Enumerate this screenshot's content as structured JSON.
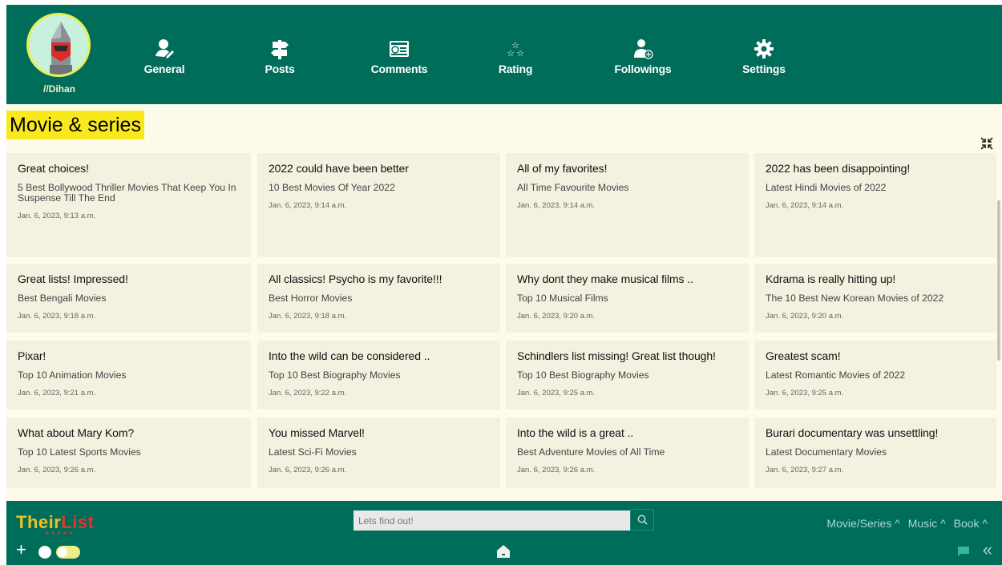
{
  "profile": {
    "username": "//Dihan"
  },
  "nav": [
    {
      "label": "General",
      "icon": "user-pencil-icon"
    },
    {
      "label": "Posts",
      "icon": "signpost-icon"
    },
    {
      "label": "Comments",
      "icon": "comment-card-icon"
    },
    {
      "label": "Rating",
      "icon": "stars-icon"
    },
    {
      "label": "Followings",
      "icon": "user-plus-icon"
    },
    {
      "label": "Settings",
      "icon": "gear-icon"
    }
  ],
  "section": {
    "title": "Movie & series"
  },
  "cards": [
    {
      "title": "Great choices!",
      "list": "5 Best Bollywood Thriller Movies That Keep You In Suspense Till The End",
      "date": "Jan. 6, 2023, 9:13 a.m."
    },
    {
      "title": "2022 could have been better",
      "list": "10 Best Movies Of Year 2022",
      "date": "Jan. 6, 2023, 9:14 a.m."
    },
    {
      "title": "All of my favorites!",
      "list": "All Time Favourite Movies",
      "date": "Jan. 6, 2023, 9:14 a.m."
    },
    {
      "title": "2022 has been disappointing!",
      "list": "Latest Hindi Movies of 2022",
      "date": "Jan. 6, 2023, 9:14 a.m."
    },
    {
      "title": "Great lists! Impressed!",
      "list": "Best Bengali Movies",
      "date": "Jan. 6, 2023, 9:18 a.m."
    },
    {
      "title": "All classics! Psycho is my favorite!!!",
      "list": "Best Horror Movies",
      "date": "Jan. 6, 2023, 9:18 a.m."
    },
    {
      "title": "Why dont they make musical films ..",
      "list": "Top 10 Musical Films",
      "date": "Jan. 6, 2023, 9:20 a.m."
    },
    {
      "title": "Kdrama is really hitting up!",
      "list": "The 10 Best New Korean Movies of 2022",
      "date": "Jan. 6, 2023, 9:20 a.m."
    },
    {
      "title": "Pixar!",
      "list": "Top 10 Animation Movies",
      "date": "Jan. 6, 2023, 9:21 a.m."
    },
    {
      "title": "Into the wild can be considered ..",
      "list": "Top 10 Best Biography Movies",
      "date": "Jan. 6, 2023, 9:22 a.m."
    },
    {
      "title": "Schindlers list missing! Great list though!",
      "list": "Top 10 Best Biography Movies",
      "date": "Jan. 6, 2023, 9:25 a.m."
    },
    {
      "title": "Greatest scam!",
      "list": "Latest Romantic Movies of 2022",
      "date": "Jan. 6, 2023, 9:25 a.m."
    },
    {
      "title": "What about Mary Kom?",
      "list": "Top 10 Latest Sports Movies",
      "date": "Jan. 6, 2023, 9:26 a.m."
    },
    {
      "title": "You missed Marvel!",
      "list": "Latest Sci-Fi Movies",
      "date": "Jan. 6, 2023, 9:26 a.m."
    },
    {
      "title": "Into the wild is a great ..",
      "list": "Best Adventure Movies of All Time",
      "date": "Jan. 6, 2023, 9:26 a.m."
    },
    {
      "title": "Burari documentary was unsettling!",
      "list": "Latest Documentary Movies",
      "date": "Jan. 6, 2023, 9:27 a.m."
    }
  ],
  "footer": {
    "logo_a": "Their",
    "logo_b": "List",
    "logo_stars": "★★★★★",
    "search_placeholder": "Lets find out!",
    "categories": [
      "Movie/Series ^",
      "Music ^",
      "Book ^"
    ]
  },
  "colors": {
    "header_bg": "#006d5b",
    "title_highlight": "#f8e81c",
    "card_bg": "#f3f1e0",
    "page_bg": "#fdfbea"
  }
}
